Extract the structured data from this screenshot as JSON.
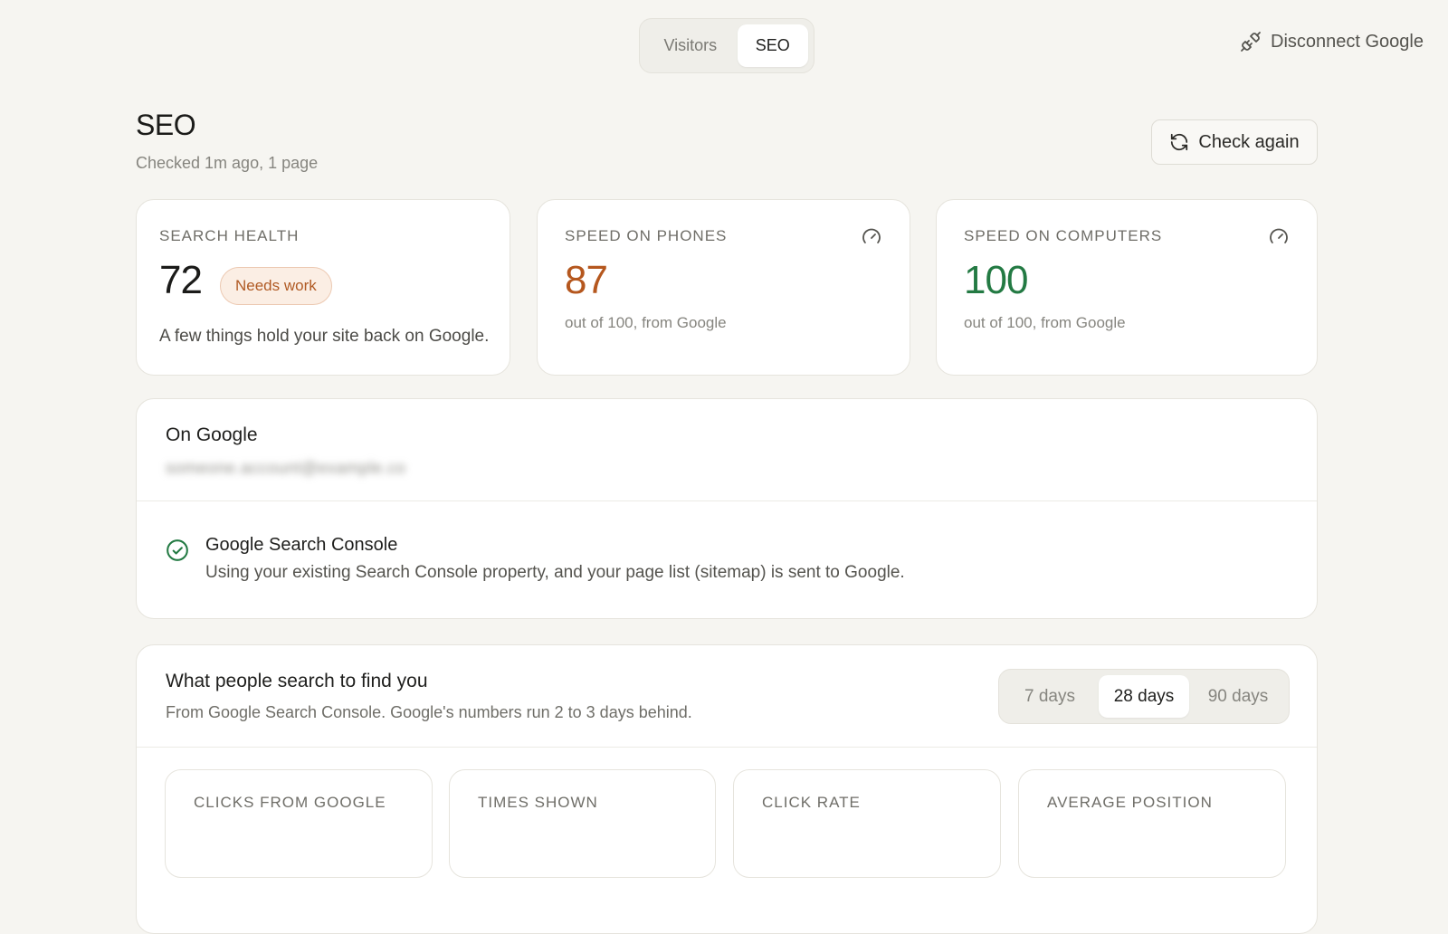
{
  "top_tabs": {
    "visitors": "Visitors",
    "seo": "SEO",
    "active": "SEO"
  },
  "disconnect": {
    "label": "Disconnect Google",
    "icon": "unplug-icon"
  },
  "header": {
    "title": "SEO",
    "subtitle": "Checked 1m ago, 1 page",
    "check_again": "Check again"
  },
  "stats": {
    "search_health": {
      "label": "SEARCH HEALTH",
      "value": "72",
      "badge": "Needs work",
      "description": "A few things hold your site back on Google."
    },
    "speed_phones": {
      "label": "SPEED ON PHONES",
      "value": "87",
      "note": "out of 100, from Google",
      "color": "#b5571e"
    },
    "speed_computers": {
      "label": "SPEED ON COMPUTERS",
      "value": "100",
      "note": "out of 100, from Google",
      "color": "#237a43"
    }
  },
  "on_google": {
    "title": "On Google",
    "account_blurred": "someone.account@example.co",
    "gsc": {
      "title": "Google Search Console",
      "description": "Using your existing Search Console property, and your page list (sitemap) is sent to Google."
    }
  },
  "search": {
    "title": "What people search to find you",
    "subtitle": "From Google Search Console. Google's numbers run 2 to 3 days behind.",
    "ranges": [
      "7 days",
      "28 days",
      "90 days"
    ],
    "active_range": "28 days",
    "metrics": [
      "CLICKS FROM GOOGLE",
      "TIMES SHOWN",
      "CLICK RATE",
      "AVERAGE POSITION"
    ]
  },
  "colors": {
    "background": "#f6f5f1",
    "accent_orange": "#b5571e",
    "accent_green": "#237a43"
  }
}
